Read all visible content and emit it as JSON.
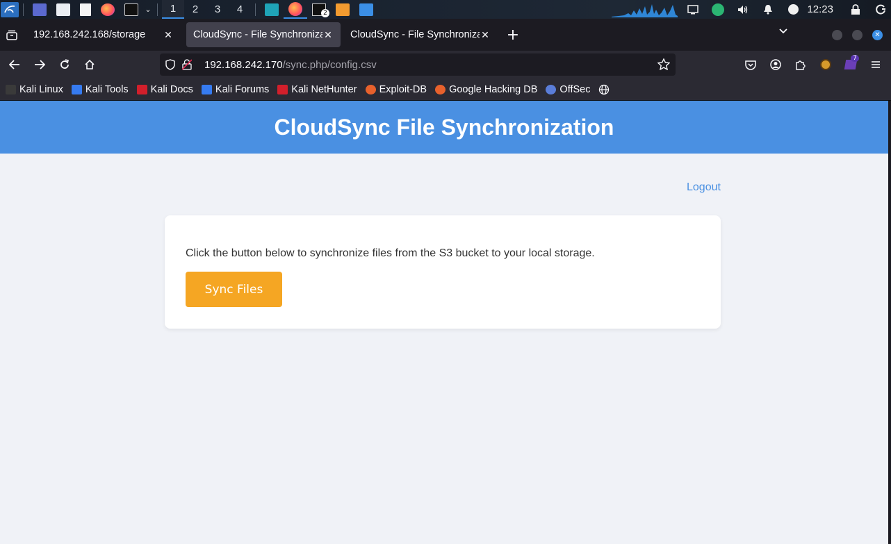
{
  "taskbar": {
    "workspaces": [
      "1",
      "2",
      "3",
      "4"
    ],
    "active_workspace": "1",
    "terminal_badge": "2",
    "clock": "12:23"
  },
  "browser": {
    "tabs": [
      {
        "title": "192.168.242.168/storage",
        "selected": false
      },
      {
        "title": "CloudSync - File Synchronization",
        "selected": true
      },
      {
        "title": "CloudSync - File Synchronization",
        "selected": false
      }
    ],
    "url_host": "192.168.242.170",
    "url_path": "/sync.php/config.csv",
    "extension_badge": "7",
    "bookmarks": [
      {
        "label": "Kali Linux",
        "color": "#3a3a3a"
      },
      {
        "label": "Kali Tools",
        "color": "#367bf0"
      },
      {
        "label": "Kali Docs",
        "color": "#d21f2b"
      },
      {
        "label": "Kali Forums",
        "color": "#367bf0"
      },
      {
        "label": "Kali NetHunter",
        "color": "#d21f2b"
      },
      {
        "label": "Exploit-DB",
        "color": "#e8612c"
      },
      {
        "label": "Google Hacking DB",
        "color": "#e8612c"
      },
      {
        "label": "OffSec",
        "color": "#5a7dd8"
      }
    ]
  },
  "page": {
    "header_title": "CloudSync File Synchronization",
    "logout_label": "Logout",
    "card_text": "Click the button below to synchronize files from the S3 bucket to your local storage.",
    "sync_button_label": "Sync Files",
    "colors": {
      "header_bg": "#4a90e2",
      "page_bg": "#f0f2f7",
      "button_bg": "#f5a623",
      "link": "#4a90e2"
    }
  }
}
